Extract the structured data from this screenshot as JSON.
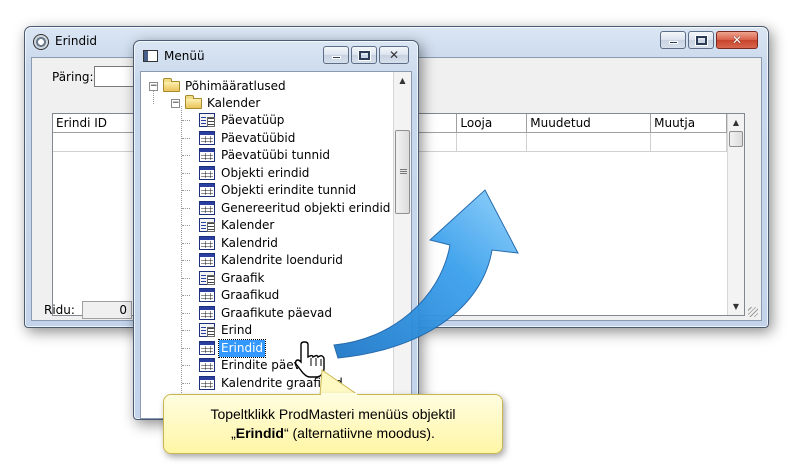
{
  "erindid_window": {
    "title": "Erindid",
    "query_label": "Päring:",
    "columns": [
      "Erindi ID",
      "Looja",
      "Muudetud",
      "Muutja"
    ],
    "status_label": "Ridu:",
    "row_count": "0"
  },
  "menu_window": {
    "title": "Menüü",
    "root": "Põhimääratlused",
    "folder": "Kalender",
    "items": [
      {
        "label": "Päevatüüp",
        "icon": "form-icon"
      },
      {
        "label": "Päevatüübid",
        "icon": "table-icon"
      },
      {
        "label": "Päevatüübi tunnid",
        "icon": "table-icon"
      },
      {
        "label": "Objekti erindid",
        "icon": "table-icon"
      },
      {
        "label": "Objekti erindite tunnid",
        "icon": "table-icon"
      },
      {
        "label": "Genereeritud objekti erindid",
        "icon": "table-icon"
      },
      {
        "label": "Kalender",
        "icon": "form-icon"
      },
      {
        "label": "Kalendrid",
        "icon": "table-icon"
      },
      {
        "label": "Kalendrite loendurid",
        "icon": "table-icon"
      },
      {
        "label": "Graafik",
        "icon": "form-icon"
      },
      {
        "label": "Graafikud",
        "icon": "table-icon"
      },
      {
        "label": "Graafikute päevad",
        "icon": "table-icon"
      },
      {
        "label": "Erind",
        "icon": "form-icon"
      },
      {
        "label": "Erindid",
        "icon": "table-icon",
        "selected": true
      },
      {
        "label": "Erindite päev",
        "icon": "table-icon"
      },
      {
        "label": "Kalendrite graafikud",
        "icon": "table-icon"
      }
    ]
  },
  "callout": {
    "line1_text": "Topeltklikk ProdMasteri menüüs objektil",
    "line2_open": "„",
    "line2_bold": "Erindid",
    "line2_rest": "“ (alternatiivne moodus)."
  },
  "colors": {
    "selection": "#3399ff",
    "arrow": "#2f8fd8",
    "callout_bg": "#fff6a6"
  }
}
